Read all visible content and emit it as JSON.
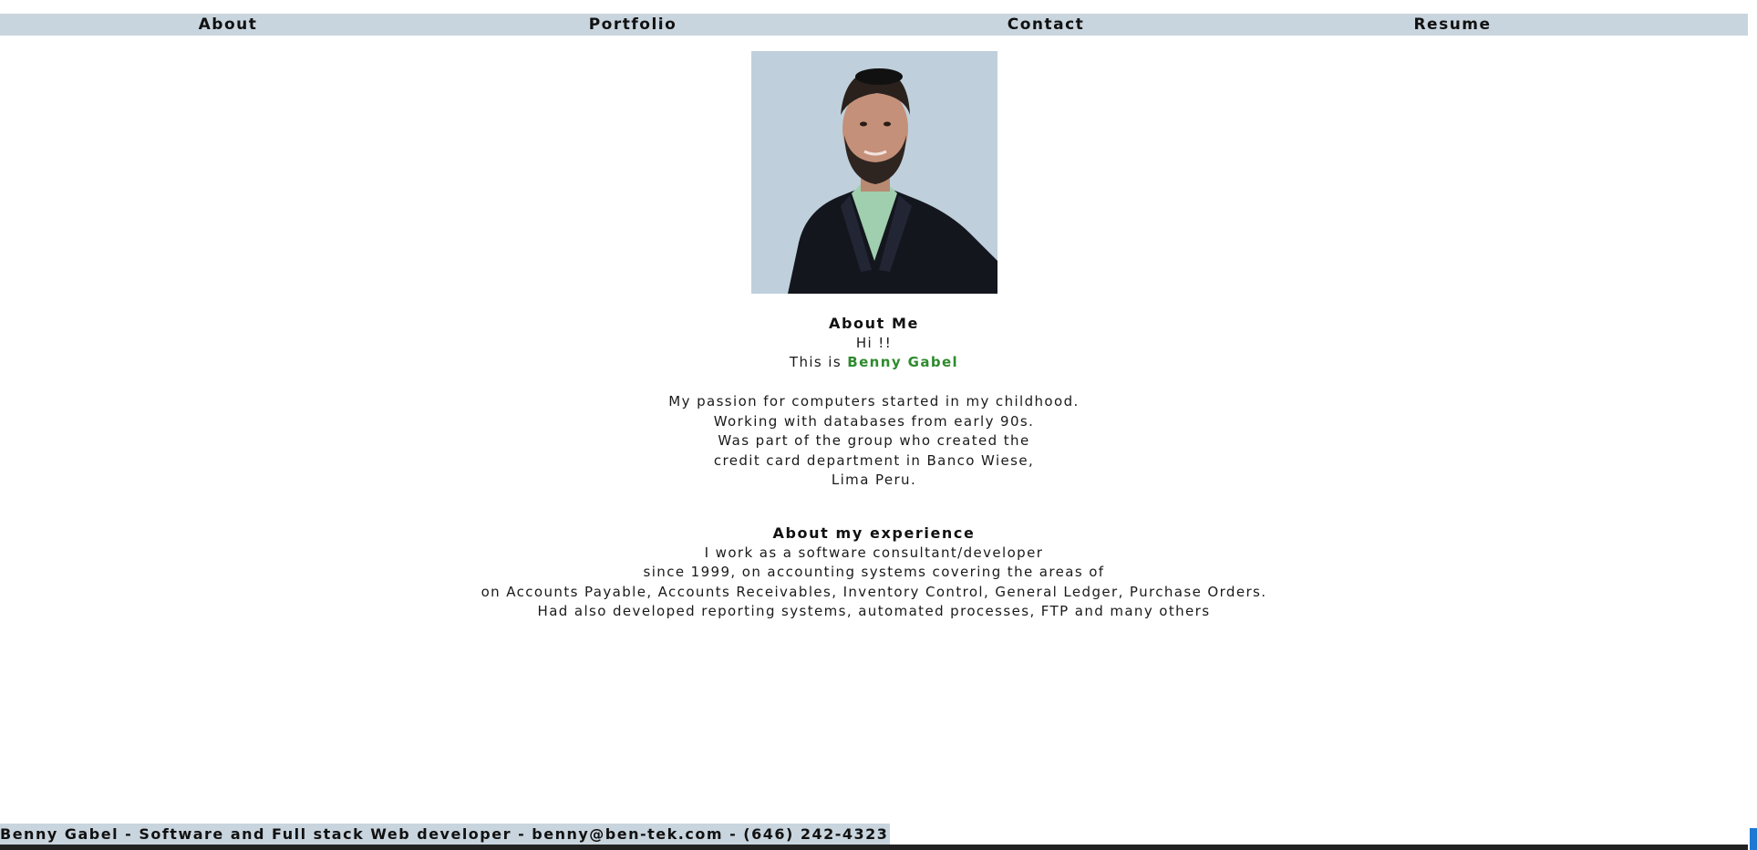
{
  "nav": {
    "items": [
      {
        "label": "About"
      },
      {
        "label": "Portfolio"
      },
      {
        "label": "Contact"
      },
      {
        "label": "Resume"
      }
    ]
  },
  "about": {
    "heading": "About Me",
    "greeting": "Hi !!",
    "intro_prefix": "This is ",
    "name": "Benny Gabel",
    "paragraph": [
      "My passion for computers started in my childhood.",
      "Working with databases from early 90s.",
      "Was part of the group who created the",
      "credit card department in Banco Wiese,",
      "Lima Peru."
    ]
  },
  "experience": {
    "heading": "About my experience",
    "paragraph": [
      "I work as a software consultant/developer",
      "since 1999, on accounting systems covering the areas of",
      "on Accounts Payable, Accounts Receivables, Inventory Control, General Ledger, Purchase Orders.",
      "Had also developed reporting systems, automated processes, FTP and many others"
    ]
  },
  "footer": {
    "text": "Benny Gabel - Software and Full stack Web developer - benny@ben-tek.com - (646) 242-4323"
  },
  "colors": {
    "nav_background": "#c9d5de",
    "name_accent": "#2e8b2e"
  }
}
